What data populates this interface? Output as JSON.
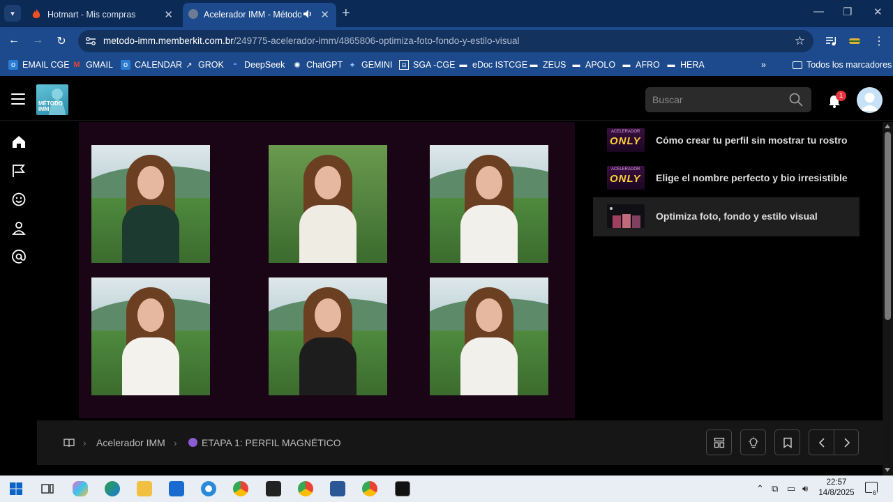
{
  "browser": {
    "tabs": [
      {
        "title": "Hotmart - Mis compras",
        "active": false
      },
      {
        "title": "Acelerador IMM - Método IMM",
        "active": true
      }
    ],
    "url_host": "metodo-imm.memberkit.com.br",
    "url_path": "/249775-acelerador-imm/4865806-optimiza-foto-fondo-y-estilo-visual",
    "bookmarks": [
      "EMAIL CGE",
      "GMAIL",
      "CALENDAR",
      "GROK",
      "DeepSeek",
      "ChatGPT",
      "GEMINI",
      "SGA -CGE",
      "eDoc ISTCGE",
      "ZEUS",
      "APOLO",
      "AFRO",
      "HERA"
    ],
    "all_bookmarks": "Todos los marcadores"
  },
  "header": {
    "logo_text": "MÉTODO IMM",
    "search_placeholder": "Buscar",
    "notification_count": "1"
  },
  "sidebar": {
    "icons": [
      "home-icon",
      "flag-icon",
      "smile-icon",
      "user-icon",
      "at-icon"
    ]
  },
  "lessons": [
    {
      "title": "Cómo crear tu perfil sin mostrar tu rostro",
      "thumb_text": "ONLY",
      "thumb_small": "ACELERADOR",
      "active": false
    },
    {
      "title": "Elige el nombre perfecto y bio irresistible",
      "thumb_text": "ONLY",
      "thumb_small": "ACELERADOR",
      "active": false
    },
    {
      "title": "Optimiza foto, fondo y estilo visual",
      "active": true
    }
  ],
  "breadcrumb": {
    "course": "Acelerador IMM",
    "stage": "ETAPA 1: PERFIL MAGNÉTICO",
    "stage_color": "#8a5cd6"
  },
  "taskbar": {
    "time": "22:57",
    "date": "14/8/2025",
    "notifications": "6"
  },
  "colors": {
    "chrome_frame": "#0b2a55",
    "chrome_toolbar": "#1c4a8c",
    "video_bg": "#1a0516",
    "badge_red": "#e8323c"
  }
}
